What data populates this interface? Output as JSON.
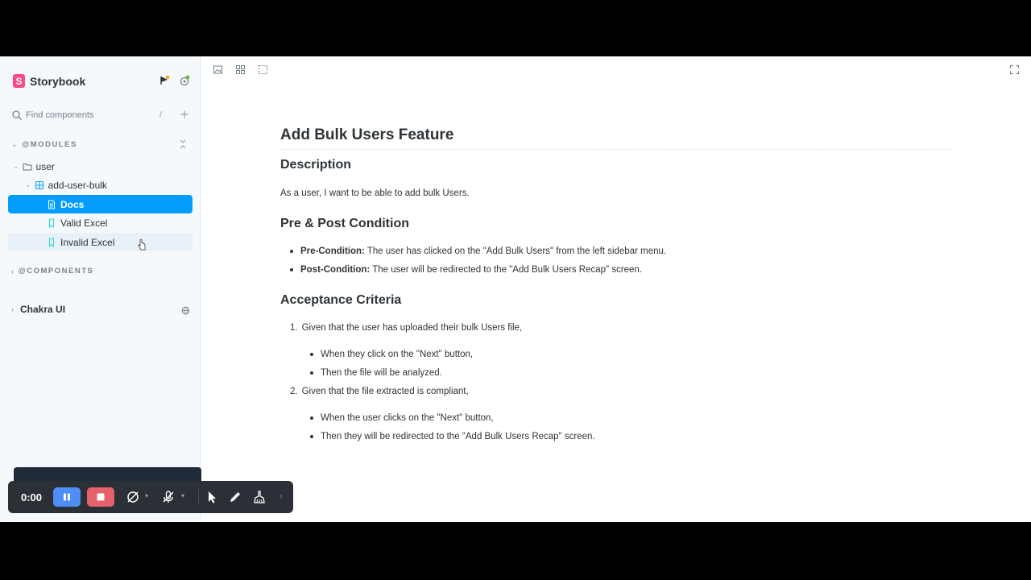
{
  "app": {
    "name": "Storybook"
  },
  "search": {
    "placeholder": "Find components",
    "shortcut": "/"
  },
  "sidebar": {
    "modules_label": "@MODULES",
    "components_label": "@COMPONENTS",
    "tree": {
      "folder": "user",
      "component": "add-user-bulk",
      "docs": "Docs",
      "stories": [
        "Valid Excel",
        "Invalid Excel"
      ]
    },
    "ref": "Chakra UI"
  },
  "doc": {
    "title": "Add Bulk Users Feature",
    "description_heading": "Description",
    "description": "As a user, I want to be able to add bulk Users.",
    "conditions_heading": "Pre & Post Condition",
    "pre_label": "Pre-Condition:",
    "pre_text": "The user has clicked on the \"Add Bulk Users\" from the left sidebar menu.",
    "post_label": "Post-Condition:",
    "post_text": "The user will be redirected to the \"Add Bulk Users Recap\" screen.",
    "criteria_heading": "Acceptance Criteria",
    "criteria": [
      {
        "num": "1.",
        "text": "Given that the user has uploaded their bulk Users file,",
        "items": [
          "When they click on the \"Next\" button,",
          "Then the file will be analyzed."
        ]
      },
      {
        "num": "2.",
        "text": "Given that the file extracted is compliant,",
        "items": [
          "When the user clicks on the \"Next\" button,",
          "Then they will be redirected to the \"Add Bulk Users Recap\" screen."
        ]
      }
    ]
  },
  "recorder": {
    "time": "0:00"
  },
  "colors": {
    "accent": "#029cfd",
    "brand": "#ff4785",
    "pause": "#4f8ef7",
    "stop": "#e5616b"
  }
}
